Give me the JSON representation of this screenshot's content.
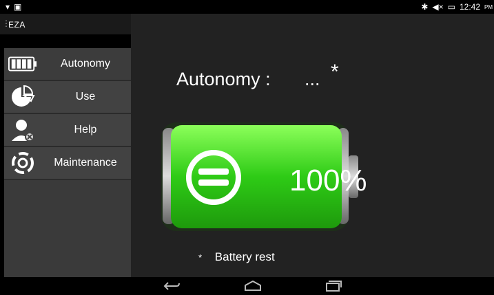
{
  "status": {
    "time": "12:42",
    "time_suffix": "PM"
  },
  "app": {
    "title": "EZA"
  },
  "sidebar": {
    "items": [
      {
        "label": "Autonomy",
        "icon": "battery-icon"
      },
      {
        "label": "Use",
        "icon": "pie-chart-icon"
      },
      {
        "label": "Help",
        "icon": "support-agent-icon"
      },
      {
        "label": "Maintenance",
        "icon": "refresh-cycle-icon"
      }
    ]
  },
  "main": {
    "title": "Autonomy :",
    "value": "...",
    "asterisk": "*",
    "battery_percent": "100%",
    "battery_level": 1.0,
    "note_marker": "*",
    "note": "Battery rest"
  },
  "colors": {
    "battery_green": "#3ddb22",
    "background": "#222222",
    "sidebar": "#424242"
  }
}
